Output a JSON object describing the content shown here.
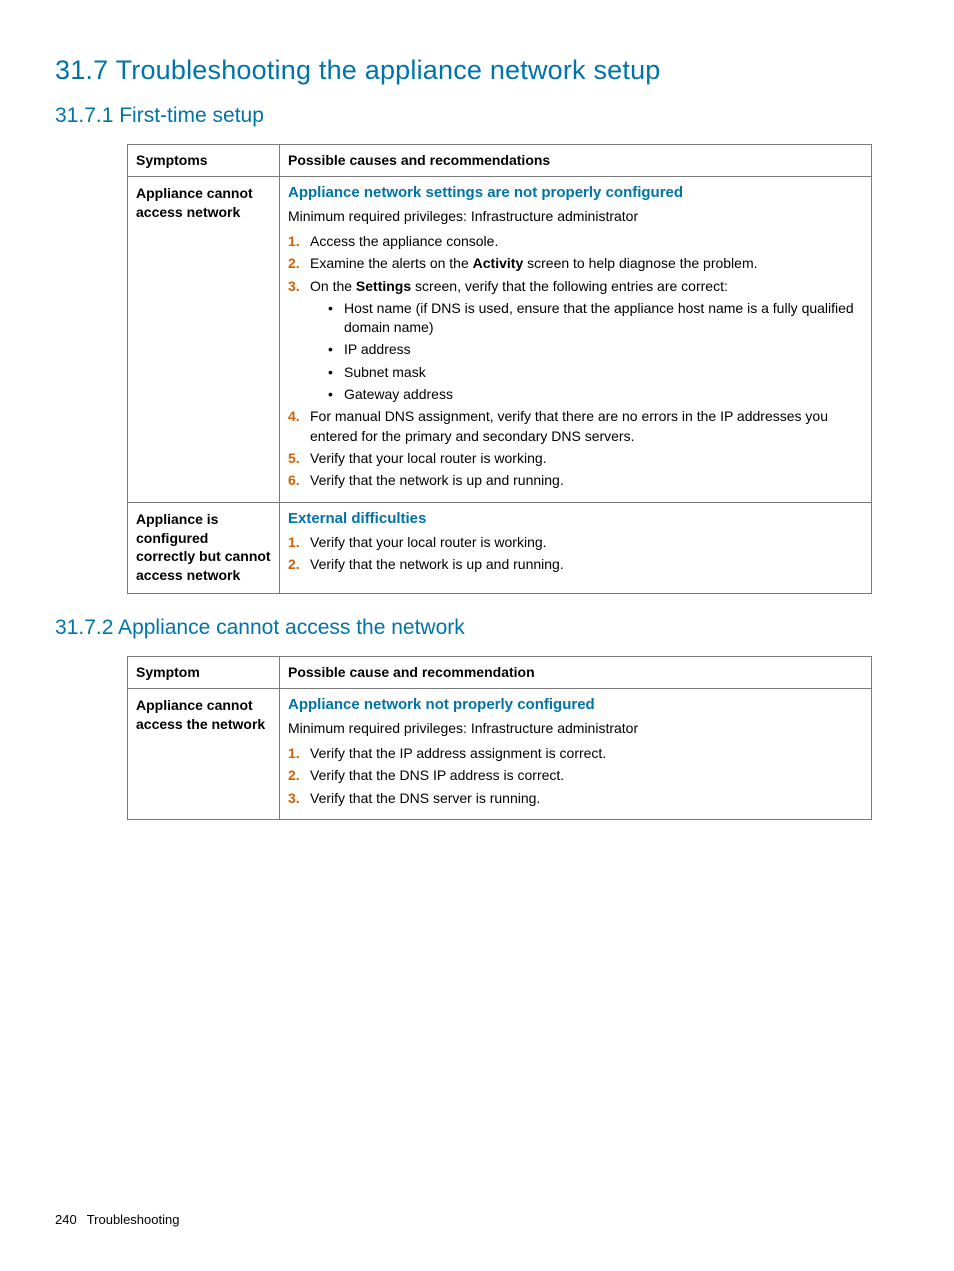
{
  "headings": {
    "h1": "31.7 Troubleshooting the appliance network setup",
    "h2a": "31.7.1 First-time setup",
    "h2b": "31.7.2 Appliance cannot access the network"
  },
  "table1": {
    "head_sym": "Symptoms",
    "head_cause": "Possible causes and recommendations",
    "row1": {
      "symptom": "Appliance cannot access network",
      "cause_heading": "Appliance network settings are not properly configured",
      "priv": "Minimum required privileges: Infrastructure administrator",
      "step1": "Access the appliance console.",
      "step2_pre": "Examine the alerts on the ",
      "step2_bold": "Activity",
      "step2_post": " screen to help diagnose the problem.",
      "step3_pre": "On the ",
      "step3_bold": "Settings",
      "step3_post": " screen, verify that the following entries are correct:",
      "bullet1": "Host name (if DNS is used, ensure that the appliance host name is a fully qualified domain name)",
      "bullet2": "IP address",
      "bullet3": "Subnet mask",
      "bullet4": "Gateway address",
      "step4": "For manual DNS assignment, verify that there are no errors in the IP addresses you entered for the primary and secondary DNS servers.",
      "step5": "Verify that your local router is working.",
      "step6": "Verify that the network is up and running."
    },
    "row2": {
      "symptom": "Appliance is configured correctly but cannot access network",
      "cause_heading": "External difficulties",
      "step1": "Verify that your local router is working.",
      "step2": "Verify that the network is up and running."
    }
  },
  "table2": {
    "head_sym": "Symptom",
    "head_cause": "Possible cause and recommendation",
    "row1": {
      "symptom": "Appliance cannot access the network",
      "cause_heading": "Appliance network not properly configured",
      "priv": "Minimum required privileges: Infrastructure administrator",
      "step1": "Verify that the IP address assignment is correct.",
      "step2": "Verify that the DNS IP address is correct.",
      "step3": "Verify that the DNS server is running."
    }
  },
  "footer": {
    "page_num": "240",
    "section": "Troubleshooting"
  }
}
